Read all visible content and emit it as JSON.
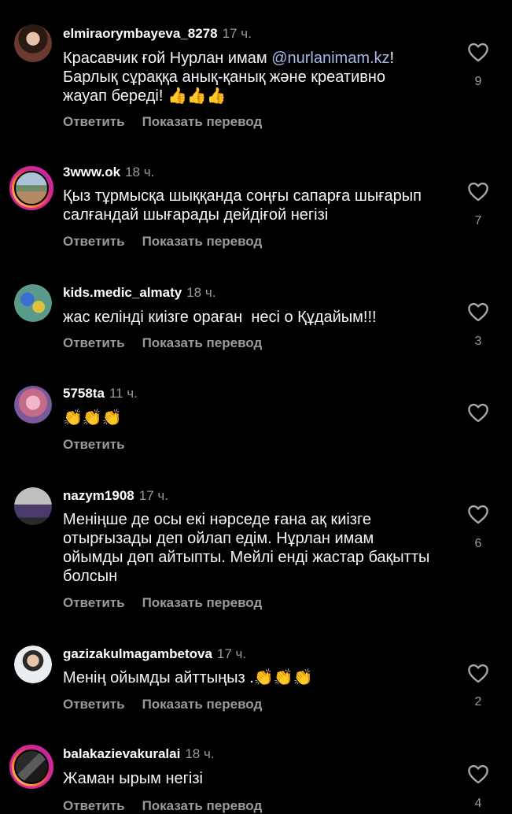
{
  "colors": {
    "background": "#000000",
    "text": "#ffffff",
    "muted": "#9a9a9a",
    "mention": "#a6b9e8",
    "story_ring": "#d6249f"
  },
  "icons": {
    "like": "heart-outline-icon"
  },
  "comments": [
    {
      "username": "elmiraorymbayeva_8278",
      "time": "17 ч.",
      "text_before": "Красавчик ғой Нурлан имам ",
      "mention": "@nurlanimam.kz",
      "text_after": "! Барлық сұраққа анық-қанық және креативно жауап береді! 👍👍👍",
      "reply_label": "Ответить",
      "translate_label": "Показать перевод",
      "likes": "9"
    },
    {
      "username": "3www.ok",
      "time": "18 ч.",
      "text": "Қыз тұрмысқа шыққанда соңғы сапарға шығарып салғандай шығарады дейдіғой негізі",
      "reply_label": "Ответить",
      "translate_label": "Показать перевод",
      "likes": "7"
    },
    {
      "username": "kids.medic_almaty",
      "time": "18 ч.",
      "text": "жас келінді киізге ораған&nbsp; несі о Құдайым!!!",
      "reply_label": "Ответить",
      "translate_label": "Показать перевод",
      "likes": "3"
    },
    {
      "username": "5758ta",
      "time": "11 ч.",
      "text": "👏👏👏",
      "reply_label": "Ответить",
      "likes": ""
    },
    {
      "username": "nazym1908",
      "time": "17 ч.",
      "text": "Меніңше де осы екі нәрседе ғана ақ киізге отырғызады деп ойлап едім. Нұрлан имам ойымды дөп айтыпты. Мейлі енді жастар бақытты болсын",
      "reply_label": "Ответить",
      "translate_label": "Показать перевод",
      "likes": "6"
    },
    {
      "username": "gazizakulmagambetova",
      "time": "17 ч.",
      "text": "Менің ойымды айттыңыз .👏👏👏",
      "reply_label": "Ответить",
      "translate_label": "Показать перевод",
      "likes": "2"
    },
    {
      "username": "balakazievakuralai",
      "time": "18 ч.",
      "text": "Жаман ырым негізі",
      "reply_label": "Ответить",
      "translate_label": "Показать перевод",
      "likes": "4"
    }
  ]
}
